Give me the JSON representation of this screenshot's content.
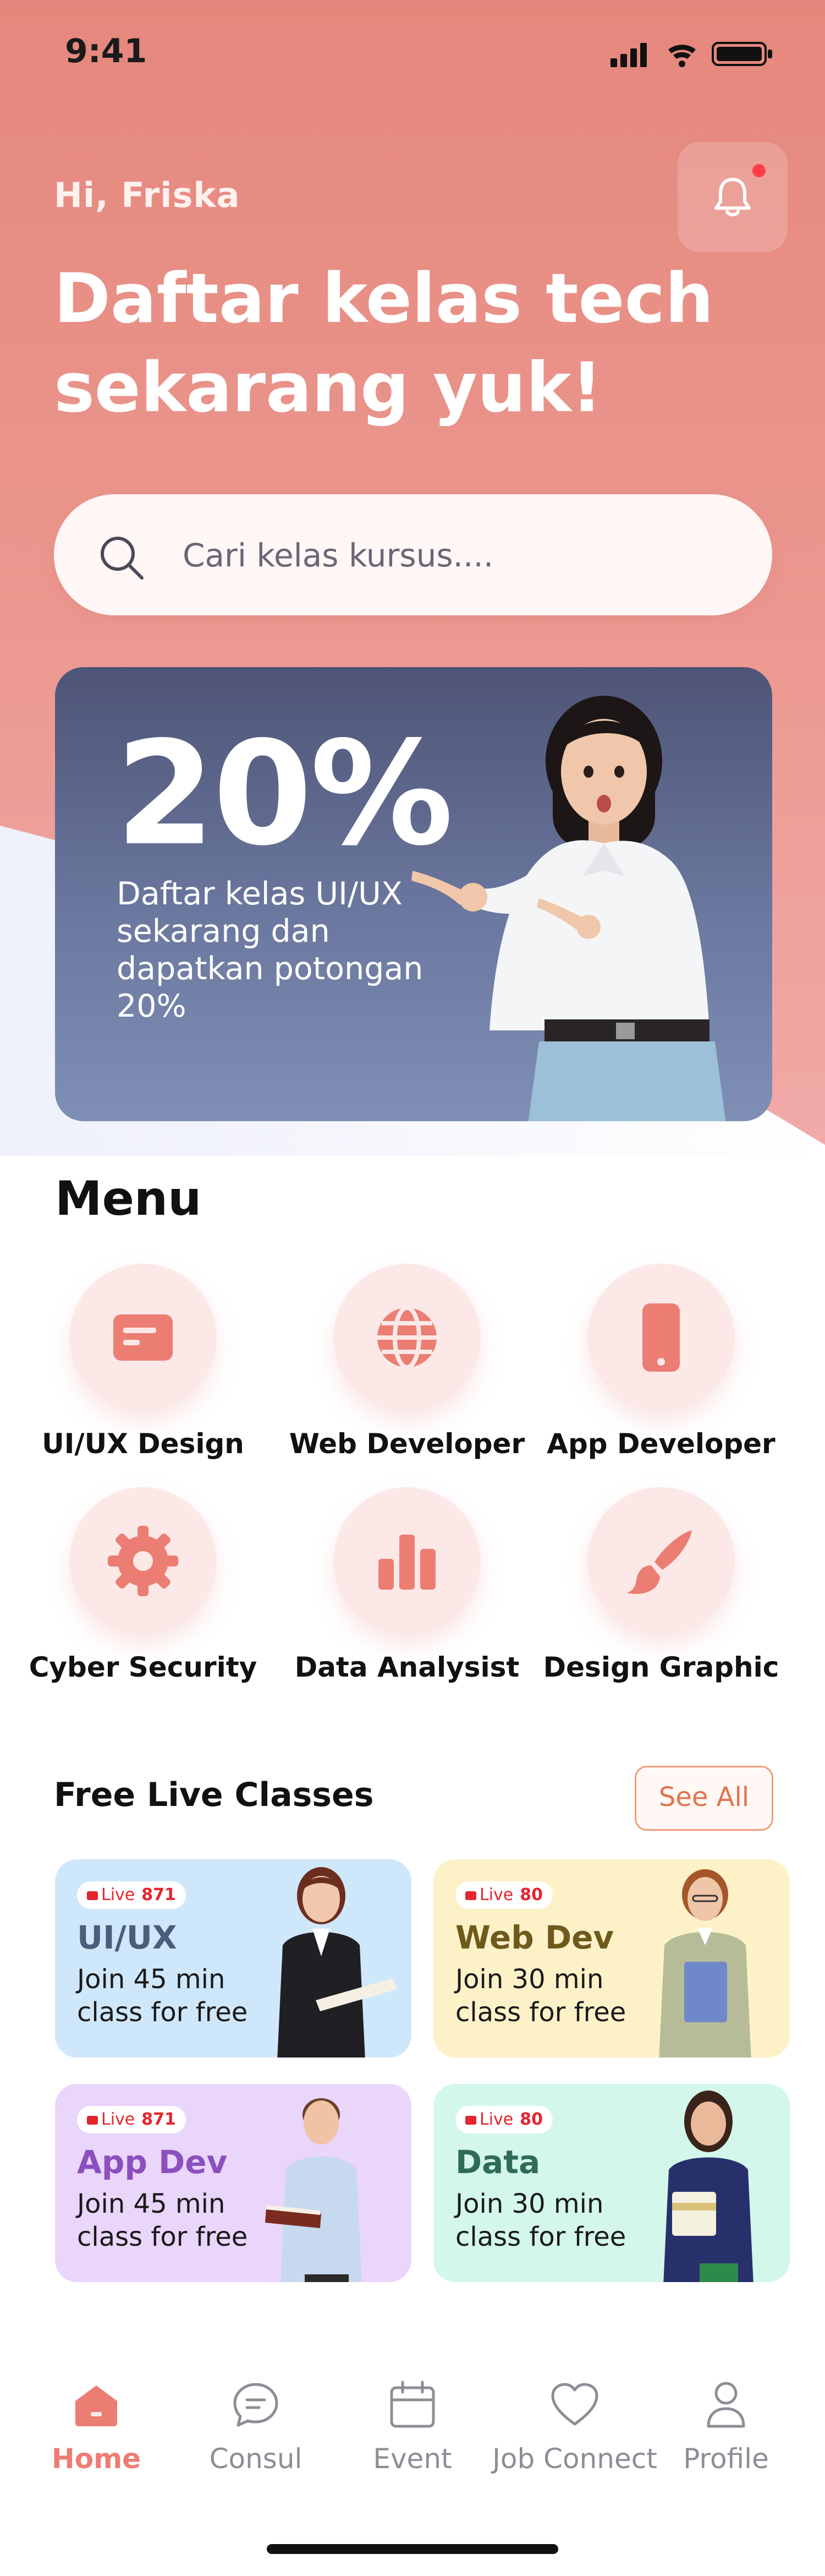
{
  "status_bar": {
    "time": "9:41"
  },
  "header": {
    "greeting": "Hi, Friska",
    "headline_line1": "Daftar kelas tech",
    "headline_line2": "sekarang yuk!",
    "notification_unread": true
  },
  "search": {
    "placeholder": "Cari kelas kursus...."
  },
  "promo": {
    "percent": "20%",
    "text": "Daftar kelas UI/UX sekarang dan dapatkan potongan 20%"
  },
  "menu": {
    "title": "Menu",
    "items": [
      {
        "label": "UI/UX Design",
        "icon": "card-icon"
      },
      {
        "label": "Web Developer",
        "icon": "globe-icon"
      },
      {
        "label": "App Developer",
        "icon": "phone-icon"
      },
      {
        "label": "Cyber Security",
        "icon": "gear-icon"
      },
      {
        "label": "Data Analysist",
        "icon": "bar-chart-icon"
      },
      {
        "label": "Design Graphic",
        "icon": "paintbrush-icon"
      }
    ]
  },
  "free_classes": {
    "title": "Free Live Classes",
    "see_all_label": "See All",
    "cards": [
      {
        "live_label": "Live",
        "count": "871",
        "title": "UI/UX",
        "desc": "Join 45 min class for free",
        "color_bg": "#cfe7fb",
        "color_title": "#4a5d7a"
      },
      {
        "live_label": "Live",
        "count": "80",
        "title": "Web Dev",
        "desc": "Join 30 min class for free",
        "color_bg": "#fdf1c8",
        "color_title": "#6e5b1c"
      },
      {
        "live_label": "Live",
        "count": "871",
        "title": "App Dev",
        "desc": "Join 45 min class for free",
        "color_bg": "#ead5fb",
        "color_title": "#8b4fbe"
      },
      {
        "live_label": "Live",
        "count": "80",
        "title": "Data",
        "desc": "Join 30 min class for free",
        "color_bg": "#d3f7eb",
        "color_title": "#2f6b57"
      }
    ]
  },
  "bottom_nav": {
    "items": [
      {
        "label": "Home",
        "icon": "home-icon",
        "active": true
      },
      {
        "label": "Consul",
        "icon": "chat-icon",
        "active": false
      },
      {
        "label": "Event",
        "icon": "calendar-icon",
        "active": false
      },
      {
        "label": "Job Connect",
        "icon": "heart-icon",
        "active": false
      },
      {
        "label": "Profile",
        "icon": "user-icon",
        "active": false
      }
    ]
  },
  "colors": {
    "brand": "#e98a7f",
    "accent": "#ec7d72",
    "promo_bg": "#5e6a90"
  }
}
